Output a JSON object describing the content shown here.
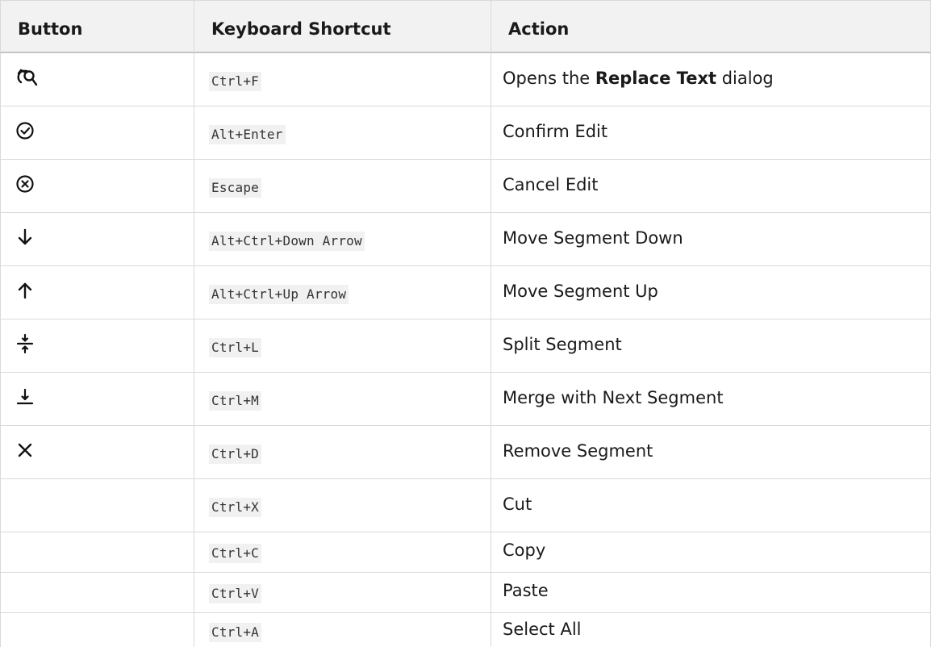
{
  "header": {
    "col_button": "Button",
    "col_shortcut": "Keyboard Shortcut",
    "col_action": "Action"
  },
  "rows": [
    {
      "icon": "replace-text-icon",
      "shortcut": "Ctrl+F",
      "action_prefix": "Opens the ",
      "action_bold": "Replace Text",
      "action_suffix": " dialog"
    },
    {
      "icon": "confirm-check-circle-icon",
      "shortcut": "Alt+Enter",
      "action": "Confirm Edit"
    },
    {
      "icon": "cancel-x-circle-icon",
      "shortcut": "Escape",
      "action": "Cancel Edit"
    },
    {
      "icon": "arrow-down-icon",
      "shortcut": "Alt+Ctrl+Down Arrow",
      "action": "Move Segment Down"
    },
    {
      "icon": "arrow-up-icon",
      "shortcut": "Alt+Ctrl+Up Arrow",
      "action": "Move Segment Up"
    },
    {
      "icon": "split-segment-icon",
      "shortcut": "Ctrl+L",
      "action": "Split Segment"
    },
    {
      "icon": "merge-segment-icon",
      "shortcut": "Ctrl+M",
      "action": "Merge with Next Segment"
    },
    {
      "icon": "remove-x-icon",
      "shortcut": "Ctrl+D",
      "action": "Remove Segment"
    },
    {
      "icon": "",
      "shortcut": "Ctrl+X",
      "action": "Cut"
    },
    {
      "icon": "",
      "shortcut": "Ctrl+C",
      "action": "Copy"
    },
    {
      "icon": "",
      "shortcut": "Ctrl+V",
      "action": "Paste"
    },
    {
      "icon": "",
      "shortcut": "Ctrl+A",
      "action": "Select All"
    }
  ]
}
